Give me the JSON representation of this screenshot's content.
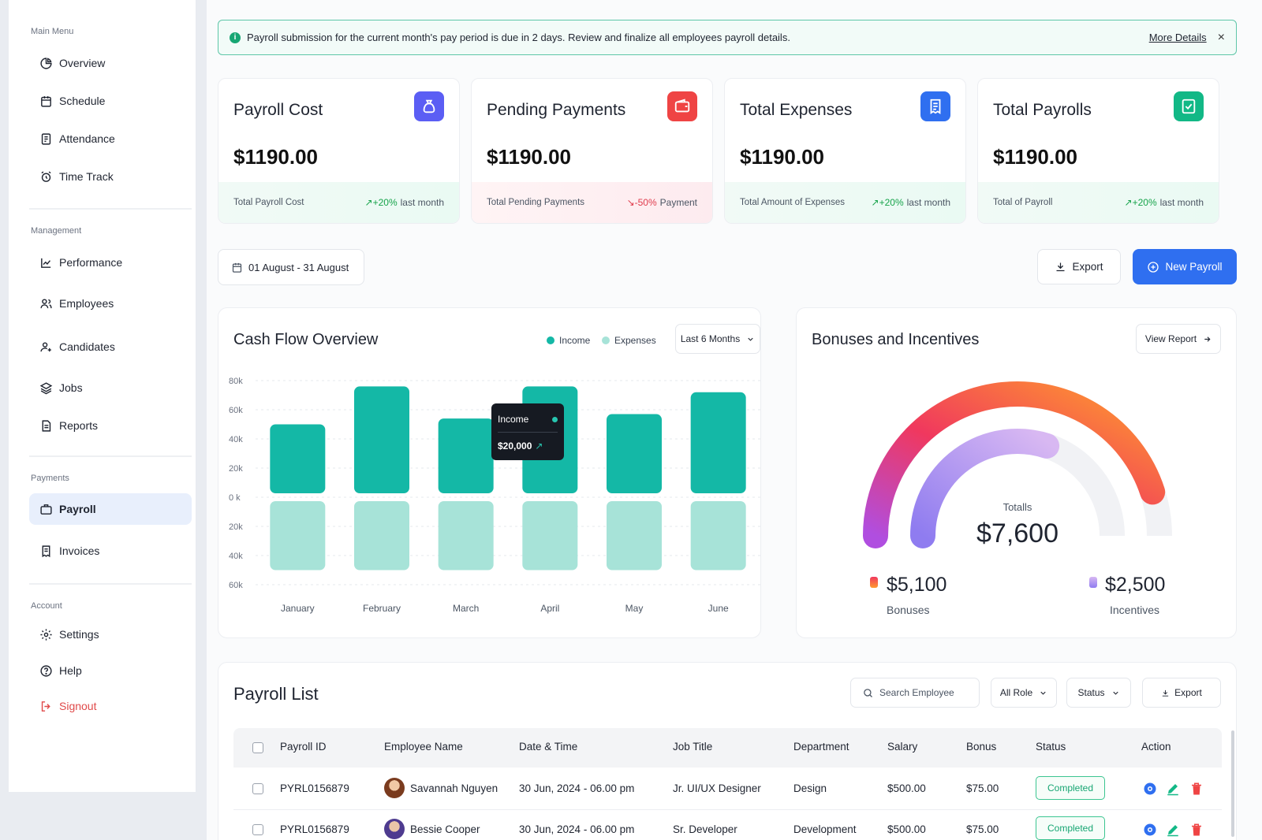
{
  "sidebar": {
    "sections": [
      "Main Menu",
      "Management",
      "Payments",
      "Account"
    ],
    "items": [
      {
        "label": "Overview"
      },
      {
        "label": "Schedule"
      },
      {
        "label": "Attendance"
      },
      {
        "label": "Time Track"
      },
      {
        "label": "Performance"
      },
      {
        "label": "Employees"
      },
      {
        "label": "Candidates"
      },
      {
        "label": "Jobs"
      },
      {
        "label": "Reports"
      },
      {
        "label": "Payroll",
        "active": true
      },
      {
        "label": "Invoices"
      },
      {
        "label": "Settings"
      },
      {
        "label": "Help"
      },
      {
        "label": "Signout"
      }
    ]
  },
  "alert": {
    "message": "Payroll submission for the current month's pay period is due in 2 days. Review and finalize all employees payroll details.",
    "link": "More Details",
    "close": "×"
  },
  "cards": [
    {
      "title": "Payroll Cost",
      "value": "$1190.00",
      "footer_label": "Total Payroll Cost",
      "change": "+20%",
      "change_suffix": "last month",
      "trend": "up",
      "icon": "money-bag-icon",
      "color": "#5b5ef4"
    },
    {
      "title": "Pending Payments",
      "value": "$1190.00",
      "footer_label": "Total Pending Payments",
      "change": "-50%",
      "change_suffix": "Payment",
      "trend": "down",
      "icon": "wallet-icon",
      "color": "#ef4444"
    },
    {
      "title": "Total Expenses",
      "value": "$1190.00",
      "footer_label": "Total Amount of Expenses",
      "change": "+20%",
      "change_suffix": "last month",
      "trend": "up",
      "icon": "receipt-icon",
      "color": "#2f6ff0"
    },
    {
      "title": "Total Payrolls",
      "value": "$1190.00",
      "footer_label": "Total of Payroll",
      "change": "+20%",
      "change_suffix": "last month",
      "trend": "up",
      "icon": "payroll-document-icon",
      "color": "#12b886"
    }
  ],
  "toolbar": {
    "date_range": "01 August - 31 August",
    "export": "Export",
    "new_payroll": "New Payroll"
  },
  "cashflow": {
    "title": "Cash Flow Overview",
    "legend_income": "Income",
    "legend_expenses": "Expenses",
    "period": "Last 6 Months",
    "tooltip_label": "Income",
    "tooltip_value": "$20,000",
    "colors": {
      "income": "#14b8a6",
      "expenses": "#a7e3d8"
    }
  },
  "chart_data": {
    "type": "bar",
    "categories": [
      "January",
      "February",
      "March",
      "April",
      "May",
      "June"
    ],
    "series": [
      {
        "name": "Income",
        "values": [
          50,
          76,
          54,
          76,
          57,
          72
        ]
      },
      {
        "name": "Expenses",
        "values": [
          -50,
          -50,
          -50,
          -50,
          -50,
          -50
        ]
      }
    ],
    "ytick_labels": [
      "80k",
      "60k",
      "40k",
      "20k",
      "0 k",
      "20k",
      "40k",
      "60k"
    ],
    "ylim": [
      -60,
      80
    ],
    "grid": true,
    "legend": "top-right"
  },
  "bonuses": {
    "title": "Bonuses and Incentives",
    "view_report": "View Report",
    "total_label": "Totalls",
    "total_value": "$7,600",
    "bonuses_value": "$5,100",
    "bonuses_label": "Bonuses",
    "incentives_value": "$2,500",
    "incentives_label": "Incentives",
    "bonuses_fraction": 0.9,
    "incentives_fraction": 0.6
  },
  "payroll_list": {
    "title": "Payroll List",
    "search_placeholder": "Search Employee",
    "role_filter": "All Role",
    "status_filter": "Status",
    "export": "Export",
    "columns": [
      "Payroll ID",
      "Employee Name",
      "Date & Time",
      "Job Title",
      "Department",
      "Salary",
      "Bonus",
      "Status",
      "Action"
    ],
    "rows": [
      {
        "id": "PYRL0156879",
        "name": "Savannah Nguyen",
        "date": "30 Jun, 2024 - 06.00 pm",
        "job": "Jr. UI/UX Designer",
        "dept": "Design",
        "salary": "$500.00",
        "bonus": "$75.00",
        "status": "Completed"
      },
      {
        "id": "PYRL0156879",
        "name": "Bessie Cooper",
        "date": "30 Jun, 2024 - 06.00 pm",
        "job": "Sr. Developer",
        "dept": "Development",
        "salary": "$500.00",
        "bonus": "$75.00",
        "status": "Completed"
      }
    ]
  }
}
